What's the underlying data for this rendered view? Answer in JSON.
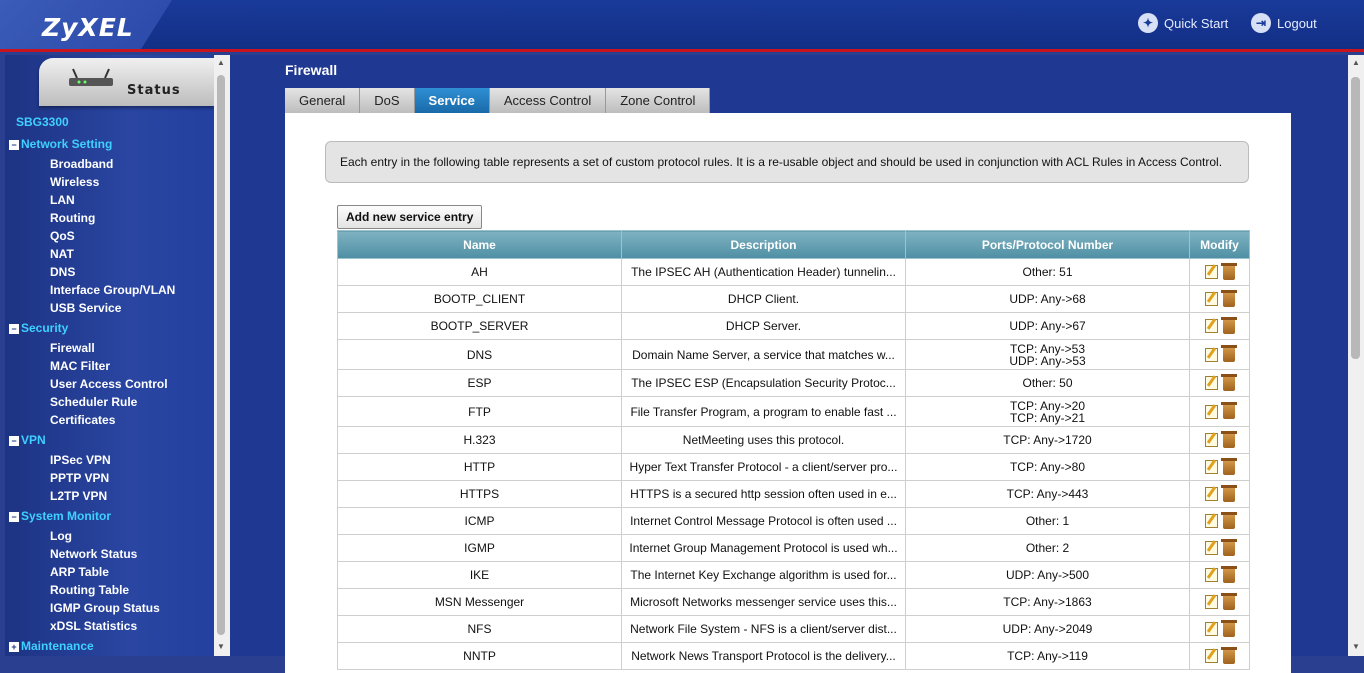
{
  "header": {
    "brand": "ZyXEL",
    "quick_start": "Quick Start",
    "logout": "Logout"
  },
  "sidebar": {
    "status_tab": "Status",
    "device": "SBG3300",
    "groups": [
      {
        "label": "Network Setting",
        "expanded": true,
        "items": [
          "Broadband",
          "Wireless",
          "LAN",
          "Routing",
          "QoS",
          "NAT",
          "DNS",
          "Interface Group/VLAN",
          "USB Service"
        ]
      },
      {
        "label": "Security",
        "expanded": true,
        "items": [
          "Firewall",
          "MAC Filter",
          "User Access Control",
          "Scheduler Rule",
          "Certificates"
        ]
      },
      {
        "label": "VPN",
        "expanded": true,
        "items": [
          "IPSec VPN",
          "PPTP VPN",
          "L2TP VPN"
        ]
      },
      {
        "label": "System Monitor",
        "expanded": true,
        "items": [
          "Log",
          "Network Status",
          "ARP Table",
          "Routing Table",
          "IGMP Group Status",
          "xDSL Statistics"
        ]
      },
      {
        "label": "Maintenance",
        "expanded": false,
        "items": []
      }
    ]
  },
  "page": {
    "title": "Firewall",
    "tabs": [
      "General",
      "DoS",
      "Service",
      "Access Control",
      "Zone Control"
    ],
    "active_tab": "Service",
    "info": "Each entry in the following table represents a set of custom protocol rules. It is a re-usable object and should be used in conjunction with ACL Rules in Access Control.",
    "add_button": "Add new service entry"
  },
  "table": {
    "headers": [
      "Name",
      "Description",
      "Ports/Protocol Number",
      "Modify"
    ],
    "rows": [
      {
        "name": "AH",
        "desc": "The IPSEC AH (Authentication Header) tunnelin...",
        "ports": [
          "Other: 51"
        ]
      },
      {
        "name": "BOOTP_CLIENT",
        "desc": "DHCP Client.",
        "ports": [
          "UDP: Any->68"
        ]
      },
      {
        "name": "BOOTP_SERVER",
        "desc": "DHCP Server.",
        "ports": [
          "UDP: Any->67"
        ]
      },
      {
        "name": "DNS",
        "desc": "Domain Name Server, a service that matches w...",
        "ports": [
          "TCP: Any->53",
          "UDP: Any->53"
        ]
      },
      {
        "name": "ESP",
        "desc": "The IPSEC ESP (Encapsulation Security Protoc...",
        "ports": [
          "Other: 50"
        ]
      },
      {
        "name": "FTP",
        "desc": "File Transfer Program, a program to enable fast ...",
        "ports": [
          "TCP: Any->20",
          "TCP: Any->21"
        ]
      },
      {
        "name": "H.323",
        "desc": "NetMeeting uses this protocol.",
        "ports": [
          "TCP: Any->1720"
        ]
      },
      {
        "name": "HTTP",
        "desc": "Hyper Text Transfer Protocol - a client/server pro...",
        "ports": [
          "TCP: Any->80"
        ]
      },
      {
        "name": "HTTPS",
        "desc": "HTTPS is a secured http session often used in e...",
        "ports": [
          "TCP: Any->443"
        ]
      },
      {
        "name": "ICMP",
        "desc": "Internet Control Message Protocol is often used ...",
        "ports": [
          "Other: 1"
        ]
      },
      {
        "name": "IGMP",
        "desc": "Internet Group Management Protocol is used wh...",
        "ports": [
          "Other: 2"
        ]
      },
      {
        "name": "IKE",
        "desc": "The Internet Key Exchange algorithm is used for...",
        "ports": [
          "UDP: Any->500"
        ]
      },
      {
        "name": "MSN Messenger",
        "desc": "Microsoft Networks messenger service uses this...",
        "ports": [
          "TCP: Any->1863"
        ]
      },
      {
        "name": "NFS",
        "desc": "Network File System - NFS is a client/server dist...",
        "ports": [
          "UDP: Any->2049"
        ]
      },
      {
        "name": "NNTP",
        "desc": "Network News Transport Protocol is the delivery...",
        "ports": [
          "TCP: Any->119"
        ]
      }
    ]
  }
}
